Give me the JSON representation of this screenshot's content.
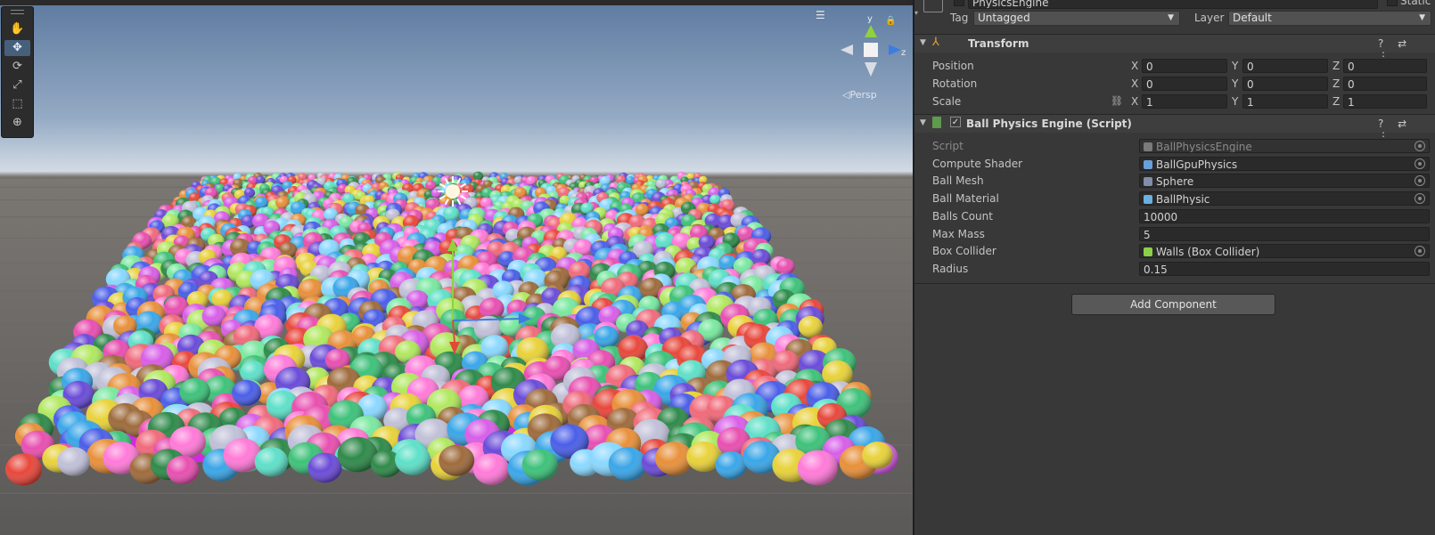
{
  "scene": {
    "tools": [
      {
        "name": "hand-tool",
        "glyph": "✋",
        "active": false
      },
      {
        "name": "move-tool",
        "glyph": "✥",
        "active": true
      },
      {
        "name": "rotate-tool",
        "glyph": "⟳",
        "active": false
      },
      {
        "name": "scale-tool",
        "glyph": "⤢",
        "active": false
      },
      {
        "name": "rect-tool",
        "glyph": "⬚",
        "active": false
      },
      {
        "name": "transform-tool",
        "glyph": "⊕",
        "active": false
      }
    ],
    "gizmo": {
      "y_label": "y",
      "z_label": "z",
      "persp_label": "◁Persp"
    },
    "ball_colors": [
      "#e8473b",
      "#3ec27a",
      "#6a4bd8",
      "#e8d23a",
      "#3aa6e8",
      "#e84fb0",
      "#9e6b3c",
      "#5ee0c8",
      "#b0e85e",
      "#d85ee8",
      "#e8903a",
      "#4a5ee8",
      "#c0c0d8",
      "#2f8a4a",
      "#f06a7a",
      "#8ad8ff",
      "#ff7ad8",
      "#7ae8a0"
    ]
  },
  "inspector": {
    "object": {
      "name": "PhysicsEngine",
      "static_label": "Static"
    },
    "tag": {
      "label": "Tag",
      "value": "Untagged"
    },
    "layer": {
      "label": "Layer",
      "value": "Default"
    },
    "transform": {
      "title": "Transform",
      "rows": [
        {
          "label": "Position",
          "x": "0",
          "y": "0",
          "z": "0"
        },
        {
          "label": "Rotation",
          "x": "0",
          "y": "0",
          "z": "0"
        },
        {
          "label": "Scale",
          "x": "1",
          "y": "1",
          "z": "1"
        }
      ],
      "axes": {
        "x": "X",
        "y": "Y",
        "z": "Z"
      }
    },
    "script": {
      "title": "Ball Physics Engine (Script)",
      "fields": [
        {
          "label": "Script",
          "value": "BallPhysicsEngine",
          "icon": "script",
          "dim": true,
          "picker": true
        },
        {
          "label": "Compute Shader",
          "value": "BallGpuPhysics",
          "icon": "shader",
          "picker": true
        },
        {
          "label": "Ball Mesh",
          "value": "Sphere",
          "icon": "mesh",
          "picker": true
        },
        {
          "label": "Ball Material",
          "value": "BallPhysic",
          "icon": "material",
          "picker": true
        },
        {
          "label": "Balls Count",
          "value": "10000"
        },
        {
          "label": "Max Mass",
          "value": "5"
        },
        {
          "label": "Box Collider",
          "value": "Walls (Box Collider)",
          "icon": "collider",
          "picker": true
        },
        {
          "label": "Radius",
          "value": "0.15"
        }
      ]
    },
    "add_component_label": "Add Component",
    "header_icons": "? ⇄ ⋮"
  },
  "colors": {
    "accent": "#46607c",
    "panel": "#383838",
    "field": "#2a2a2a"
  }
}
